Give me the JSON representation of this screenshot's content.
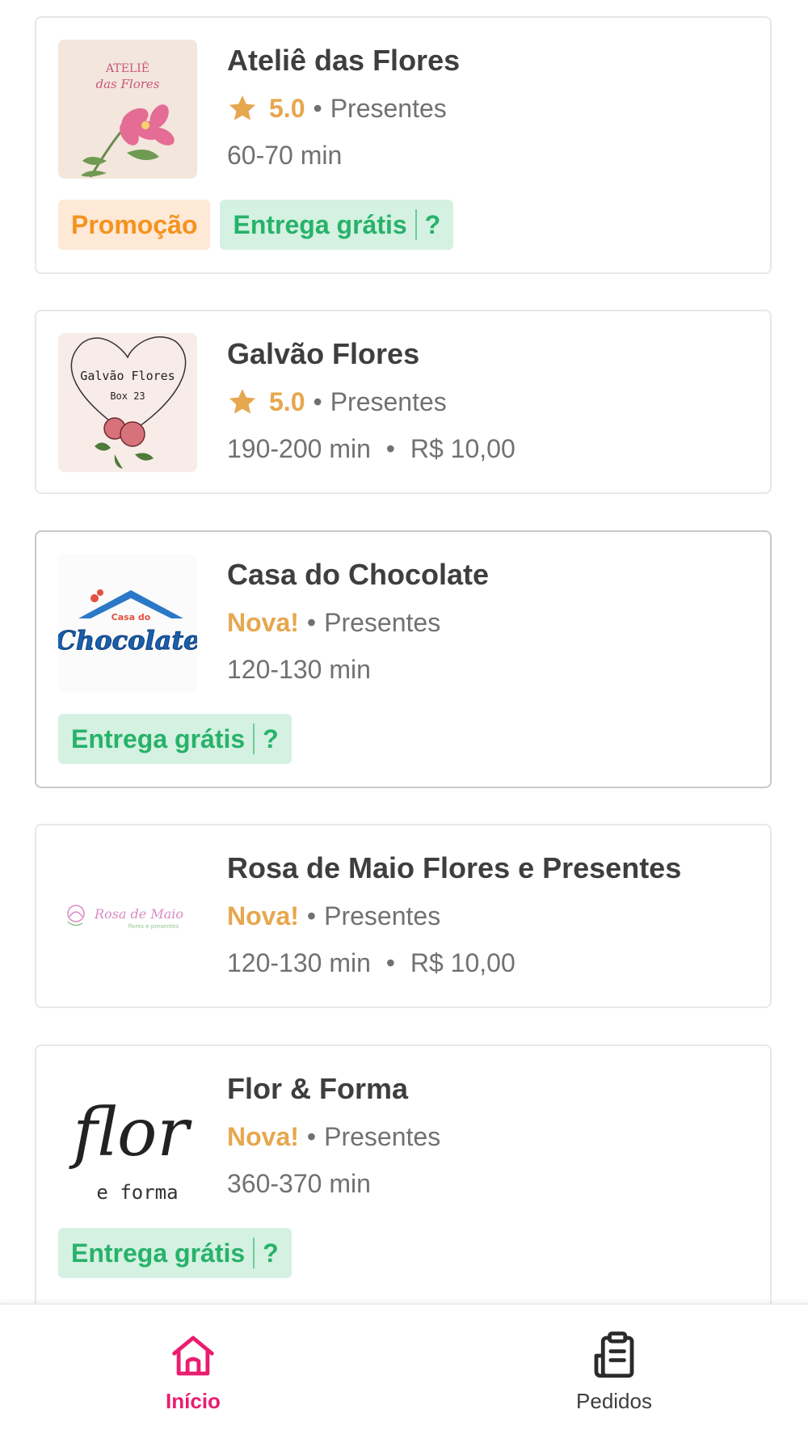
{
  "stores": [
    {
      "name": "Ateliê das Flores",
      "rating": "5.0",
      "category": "Presentes",
      "delivery_time": "60-70 min",
      "delivery_fee": "",
      "logo_text": [
        "ATELIÊ",
        "das Flores"
      ],
      "tags": {
        "promo": "Promoção",
        "free": "Entrega grátis",
        "help": "?"
      }
    },
    {
      "name": "Galvão Flores",
      "rating": "5.0",
      "category": "Presentes",
      "delivery_time": "190-200 min",
      "delivery_fee": "R$ 10,00",
      "logo_text": [
        "Galvão Flores",
        "Box 23"
      ]
    },
    {
      "name": "Casa do Chocolate",
      "badge": "Nova!",
      "category": "Presentes",
      "delivery_time": "120-130 min",
      "delivery_fee": "",
      "logo_text": [
        "Casa do",
        "Chocolate"
      ],
      "tags": {
        "free": "Entrega grátis",
        "help": "?"
      }
    },
    {
      "name": "Rosa de Maio Flores e Presentes",
      "badge": "Nova!",
      "category": "Presentes",
      "delivery_time": "120-130 min",
      "delivery_fee": "R$ 10,00",
      "logo_text": [
        "Rosa de Maio",
        "flores e presentes"
      ]
    },
    {
      "name": "Flor & Forma",
      "badge": "Nova!",
      "category": "Presentes",
      "delivery_time": "360-370 min",
      "delivery_fee": "",
      "logo_text": [
        "flor",
        "e forma"
      ],
      "tags": {
        "free": "Entrega grátis",
        "help": "?"
      }
    }
  ],
  "separator": "•",
  "nav": {
    "home": "Início",
    "orders": "Pedidos"
  },
  "colors": {
    "accent": "#ea1d6f",
    "rating": "#e7a74e",
    "promo_text": "#f5921e",
    "promo_bg": "#fde9d6",
    "free_text": "#27b26a",
    "free_bg": "#d4f1e1"
  }
}
